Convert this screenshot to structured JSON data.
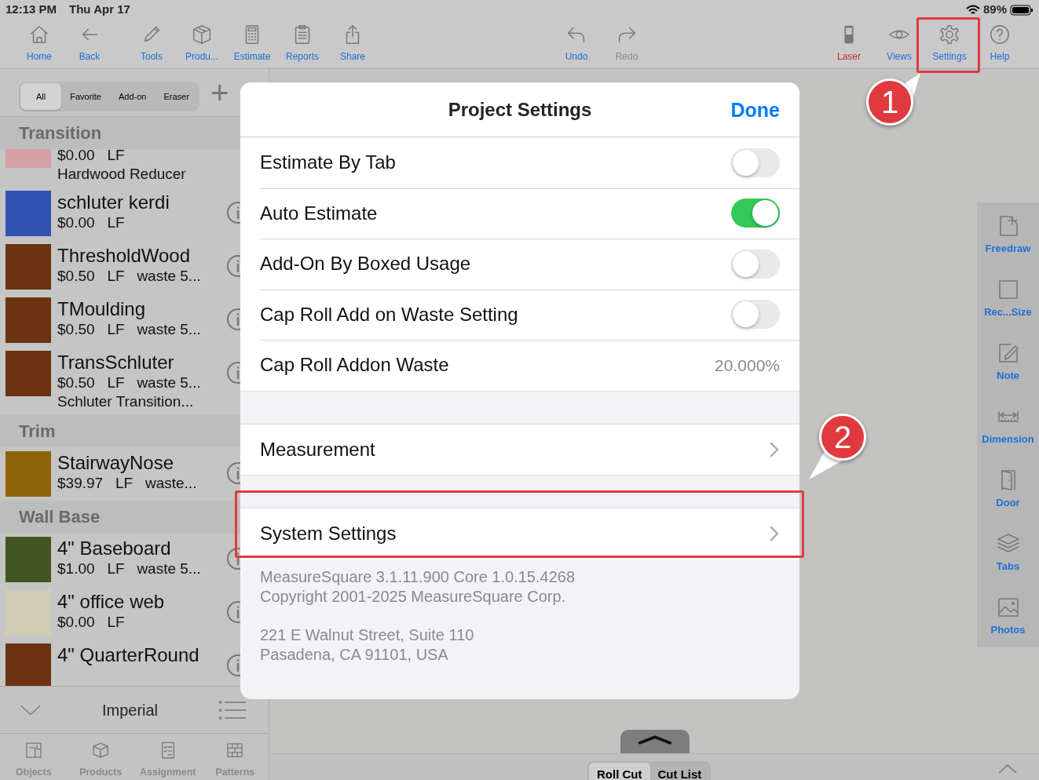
{
  "status_bar": {
    "time": "12:13 PM",
    "date": "Thu Apr 17",
    "battery": "89%"
  },
  "toolbar": {
    "left": [
      {
        "label": "Home",
        "color": "#1f6fd6"
      },
      {
        "label": "Back",
        "color": "#1f6fd6"
      },
      {
        "label": "Tools",
        "color": "#1f6fd6"
      },
      {
        "label": "Produ...",
        "color": "#1f6fd6"
      },
      {
        "label": "Estimate",
        "color": "#1f6fd6"
      },
      {
        "label": "Reports",
        "color": "#1f6fd6"
      },
      {
        "label": "Share",
        "color": "#1f6fd6"
      }
    ],
    "center": [
      {
        "label": "Undo",
        "color": "#1f6fd6"
      },
      {
        "label": "Redo",
        "color": "#8a8a8a"
      }
    ],
    "right": [
      {
        "label": "Laser",
        "color": "#c8302c"
      },
      {
        "label": "Views",
        "color": "#1f6fd6"
      },
      {
        "label": "Settings",
        "color": "#1f6fd6"
      },
      {
        "label": "Help",
        "color": "#1f6fd6"
      }
    ]
  },
  "filter_tabs": [
    {
      "label": "All",
      "selected": true
    },
    {
      "label": "Favorite",
      "selected": false
    },
    {
      "label": "Add-on",
      "selected": false
    },
    {
      "label": "Eraser",
      "selected": false
    }
  ],
  "add_button": "+",
  "product_list": [
    {
      "kind": "header",
      "title": "Transition"
    },
    {
      "kind": "item",
      "color": "#d4a0a6",
      "lines": [
        "$0.00   LF",
        "Hardwood Reducer"
      ]
    },
    {
      "kind": "item",
      "color": "#2f52b3",
      "name": "schluter kerdi",
      "lines": [
        "$0.00   LF"
      ]
    },
    {
      "kind": "item",
      "color": "#6b3310",
      "name": "ThresholdWood",
      "lines": [
        "$0.50   LF   waste 5..."
      ]
    },
    {
      "kind": "item",
      "color": "#6b3310",
      "name": "TMoulding",
      "lines": [
        "$0.50   LF   waste 5..."
      ]
    },
    {
      "kind": "item",
      "color": "#6b3310",
      "name": "TransSchluter",
      "lines": [
        "$0.50   LF   waste 5...",
        "Schluter Transition..."
      ]
    },
    {
      "kind": "header",
      "title": "Trim"
    },
    {
      "kind": "item",
      "color": "#8d6508",
      "name": "StairwayNose",
      "lines": [
        "$39.97   LF   waste..."
      ]
    },
    {
      "kind": "header",
      "title": "Wall Base"
    },
    {
      "kind": "item",
      "color": "#435523",
      "name": "4\" Baseboard",
      "lines": [
        "$1.00   LF   waste 5..."
      ]
    },
    {
      "kind": "item",
      "color": "#cfcdb4",
      "name": "4\" office web",
      "lines": [
        "$0.00   LF"
      ]
    },
    {
      "kind": "item",
      "color": "#6b3310",
      "name": "4\" QuarterRound"
    }
  ],
  "unit_bar": {
    "label": "Imperial"
  },
  "bottom_tabs": [
    {
      "label": "Objects"
    },
    {
      "label": "Products"
    },
    {
      "label": "Assignment"
    },
    {
      "label": "Patterns"
    }
  ],
  "side_tools": [
    {
      "label": "Freedraw"
    },
    {
      "label": "Rec...Size"
    },
    {
      "label": "Note"
    },
    {
      "label": "Dimension"
    },
    {
      "label": "Door"
    },
    {
      "label": "Tabs"
    },
    {
      "label": "Photos"
    }
  ],
  "cut_tabs": [
    {
      "label": "Roll Cut",
      "selected": true
    },
    {
      "label": "Cut List",
      "selected": false
    }
  ],
  "dialog": {
    "title": "Project Settings",
    "done": "Done",
    "sections": [
      [
        {
          "kind": "toggle",
          "label": "Estimate By Tab",
          "on": false
        },
        {
          "kind": "toggle",
          "label": "Auto Estimate",
          "on": true
        },
        {
          "kind": "toggle",
          "label": "Add-On By Boxed Usage",
          "on": false
        },
        {
          "kind": "toggle",
          "label": "Cap Roll Add on Waste Setting",
          "on": false
        },
        {
          "kind": "value",
          "label": "Cap Roll Addon Waste",
          "value": "20.000%"
        }
      ],
      [
        {
          "kind": "nav",
          "label": "Measurement"
        }
      ],
      [
        {
          "kind": "nav",
          "label": "System Settings"
        }
      ]
    ],
    "footer": [
      [
        "MeasureSquare 3.1.11.900    Core 1.0.15.4268",
        "Copyright 2001-2025 MeasureSquare Corp."
      ],
      [
        "221 E Walnut Street, Suite 110",
        "Pasadena, CA 91101, USA"
      ]
    ]
  },
  "annotations": [
    {
      "label": "1"
    },
    {
      "label": "2"
    }
  ]
}
